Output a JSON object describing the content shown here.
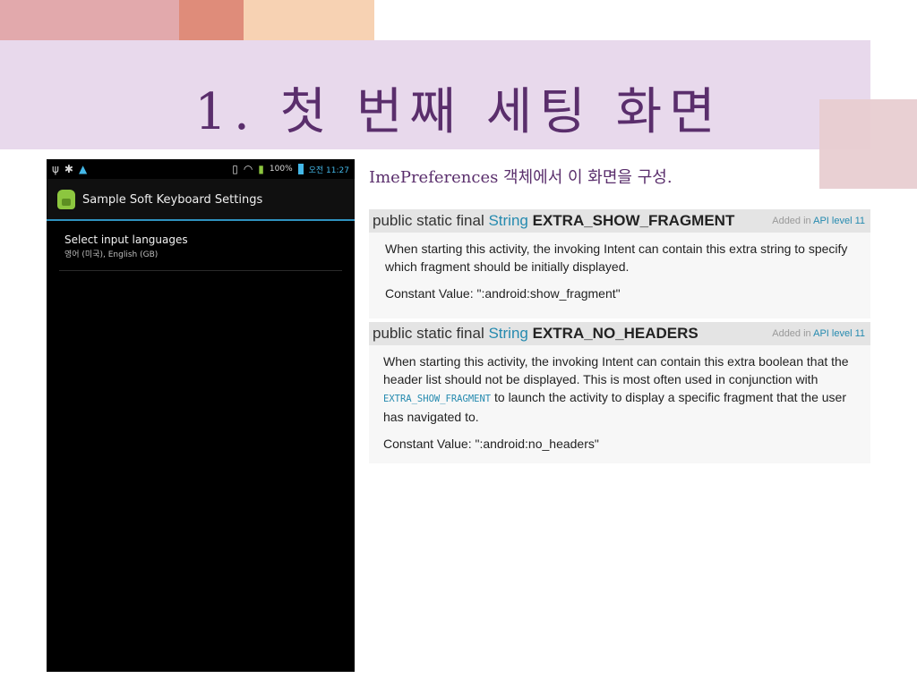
{
  "slide": {
    "title": "1. 첫 번째 세팅 화면",
    "caption": "ImePreferences 객체에서 이 화면을 구성."
  },
  "phone": {
    "status": {
      "left_icons": [
        "usb-icon",
        "debug-icon",
        "download-icon"
      ],
      "right_icons": [
        "vibrate-icon",
        "wifi-icon",
        "signal-icon"
      ],
      "battery_text": "100%",
      "time": "오전 11:27"
    },
    "app_title": "Sample Soft Keyboard Settings",
    "pref": {
      "title": "Select input languages",
      "summary": "영어 (미국), English (GB)"
    }
  },
  "docs": [
    {
      "sig_prefix": "public static final ",
      "sig_type": "String",
      "sig_name": "EXTRA_SHOW_FRAGMENT",
      "added_label": "Added in ",
      "api_link": "API level 11",
      "description": "When starting this activity, the invoking Intent can contain this extra string to specify which fragment should be initially displayed.",
      "constant": "Constant Value: \":android:show_fragment\""
    },
    {
      "sig_prefix": "public static final ",
      "sig_type": "String",
      "sig_name": "EXTRA_NO_HEADERS",
      "added_label": "Added in ",
      "api_link": "API level 11",
      "description_part1": "When starting this activity, the invoking Intent can contain this extra boolean that the header list should not be displayed. This is most often used in conjunction with ",
      "code_ref": "EXTRA_SHOW_FRAGMENT",
      "description_part2": " to launch the activity to display a specific fragment that the user has navigated to.",
      "constant": "Constant Value: \":android:no_headers\""
    }
  ],
  "colors": {
    "title": "#5a2e6c",
    "title_band": "#e8d9ec",
    "link": "#258aaf",
    "android_accent": "#2f92c0"
  }
}
